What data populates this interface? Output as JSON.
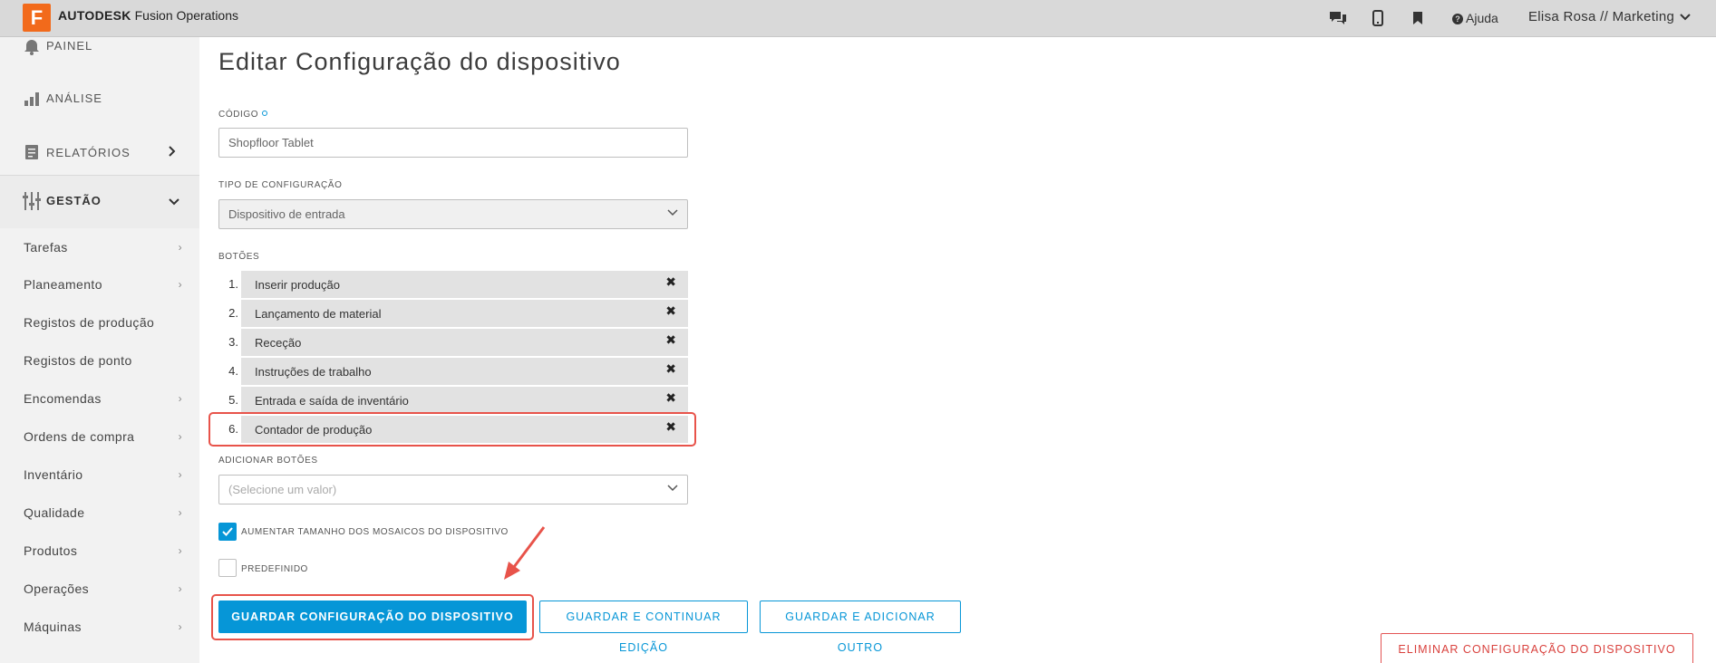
{
  "app": {
    "logo_letter": "F",
    "brand_bold": "AUTODESK",
    "brand_rest": " Fusion Operations",
    "help_label": "Ajuda",
    "user_label": "Elisa Rosa // Marketing"
  },
  "sidebar": {
    "top_items": [
      {
        "label": "PAINEL",
        "icon": "bell-icon"
      },
      {
        "label": "ANÁLISE",
        "icon": "bar-chart-icon"
      },
      {
        "label": "RELATÓRIOS",
        "icon": "report-icon"
      },
      {
        "label": "GESTÃO",
        "icon": "sliders-icon"
      }
    ],
    "items": [
      {
        "label": "Tarefas"
      },
      {
        "label": "Planeamento"
      },
      {
        "label": "Registos de produção"
      },
      {
        "label": "Registos de ponto"
      },
      {
        "label": "Encomendas"
      },
      {
        "label": "Ordens de compra"
      },
      {
        "label": "Inventário"
      },
      {
        "label": "Qualidade"
      },
      {
        "label": "Produtos"
      },
      {
        "label": "Operações"
      },
      {
        "label": "Máquinas"
      }
    ]
  },
  "form": {
    "title": "Editar Configuração do dispositivo",
    "code_label": "CÓDIGO",
    "code_value": "Shopfloor Tablet",
    "config_type_label": "TIPO DE CONFIGURAÇÃO",
    "config_type_value": "Dispositivo de entrada",
    "buttons_label": "BOTÕES",
    "buttons": [
      {
        "num": "1.",
        "label": "Inserir produção"
      },
      {
        "num": "2.",
        "label": "Lançamento de material"
      },
      {
        "num": "3.",
        "label": "Receção"
      },
      {
        "num": "4.",
        "label": "Instruções de trabalho"
      },
      {
        "num": "5.",
        "label": "Entrada e saída de inventário"
      },
      {
        "num": "6.",
        "label": "Contador de produção"
      }
    ],
    "remove_glyph": "✖",
    "add_buttons_label": "ADICIONAR BOTÕES",
    "add_buttons_placeholder": "(Selecione um valor)",
    "increase_tiles_label": "AUMENTAR TAMANHO DOS MOSAICOS DO DISPOSITIVO",
    "increase_tiles_checked": true,
    "default_label": "PREDEFINIDO",
    "default_checked": false
  },
  "actions": {
    "save": "GUARDAR CONFIGURAÇÃO DO DISPOSITIVO",
    "save_continue": "GUARDAR E CONTINUAR EDIÇÃO",
    "save_add": "GUARDAR E ADICIONAR OUTRO",
    "delete": "ELIMINAR CONFIGURAÇÃO DO DISPOSITIVO"
  },
  "colors": {
    "accent": "#0696d7",
    "highlight": "#e8534a",
    "logo": "#f26a1b",
    "danger": "#d9413d"
  }
}
